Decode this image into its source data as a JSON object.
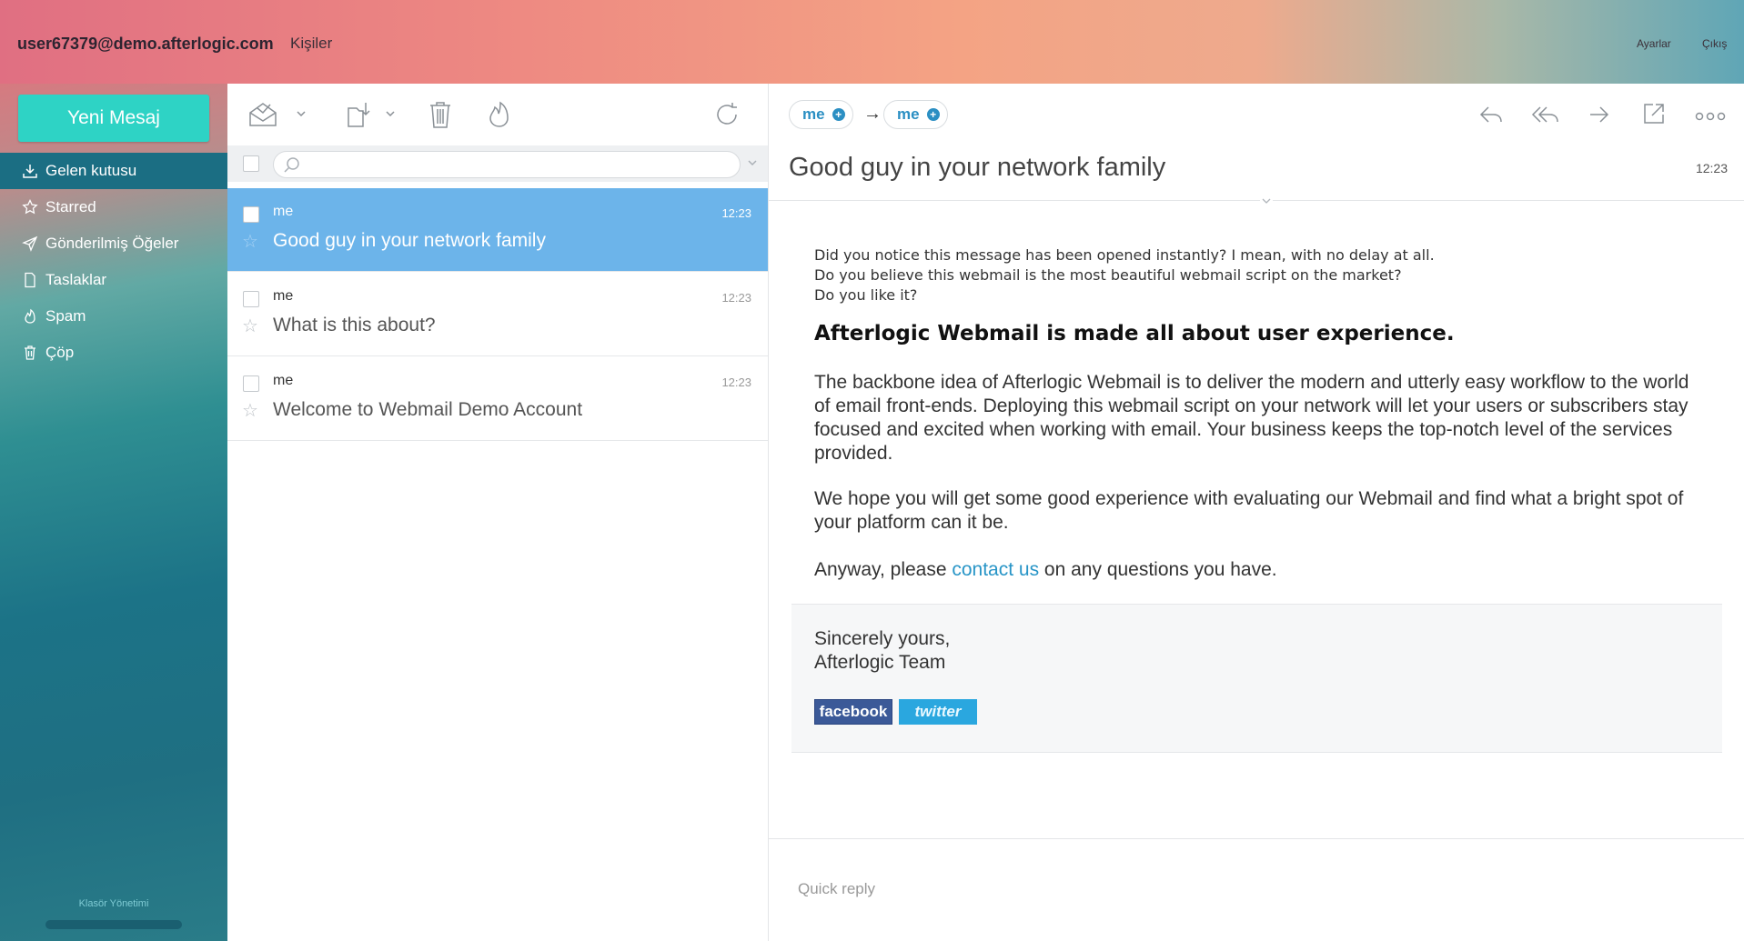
{
  "header": {
    "account": "user67379@demo.afterlogic.com",
    "contacts": "Kişiler",
    "settings": "Ayarlar",
    "logout": "Çıkış"
  },
  "sidebar": {
    "new_message": "Yeni Mesaj",
    "folders": [
      {
        "label": "Gelen kutusu",
        "icon": "inbox-download-icon",
        "active": true
      },
      {
        "label": "Starred",
        "icon": "star-icon"
      },
      {
        "label": "Gönderilmiş Öğeler",
        "icon": "paper-plane-icon"
      },
      {
        "label": "Taslaklar",
        "icon": "document-icon"
      },
      {
        "label": "Spam",
        "icon": "flame-icon"
      },
      {
        "label": "Çöp",
        "icon": "trash-icon"
      }
    ],
    "folder_manage": "Klasör Yönetimi"
  },
  "list": {
    "toolbar_icons": [
      "mark-read-icon",
      "move-to-folder-icon",
      "delete-icon",
      "spam-icon",
      "refresh-icon"
    ],
    "search_placeholder": "",
    "messages": [
      {
        "from": "me",
        "time": "12:23",
        "subject": "Good guy in your network family",
        "selected": true
      },
      {
        "from": "me",
        "time": "12:23",
        "subject": "What is this about?"
      },
      {
        "from": "me",
        "time": "12:23",
        "subject": "Welcome to Webmail Demo Account"
      }
    ]
  },
  "reader": {
    "from": "me",
    "to": "me",
    "arrow": "→",
    "subject": "Good guy in your network family",
    "time": "12:23",
    "intro": [
      "Did you notice this message has been opened instantly? I mean, with no delay at all.",
      "Do you believe this webmail is the most beautiful webmail script on the market?",
      "Do you like it?"
    ],
    "heading": "Afterlogic Webmail is made all about user experience.",
    "paragraph1": "The backbone idea of Afterlogic Webmail is to deliver the modern and utterly easy workflow to the world of email front-ends. Deploying this webmail script on your network will let your users or subscribers stay focused and excited when working with email. Your business keeps the top-notch level of the services provided.",
    "paragraph2": "We hope you will get some good experience with evaluating our Webmail and find what a bright spot of your platform can it be.",
    "p3_before": "Anyway, please ",
    "p3_link": "contact us",
    "p3_after": " on any questions you have.",
    "signature_line1": "Sincerely yours,",
    "signature_line2": "Afterlogic Team",
    "facebook": "facebook",
    "twitter": "twitter",
    "quick_reply": "Quick reply"
  }
}
